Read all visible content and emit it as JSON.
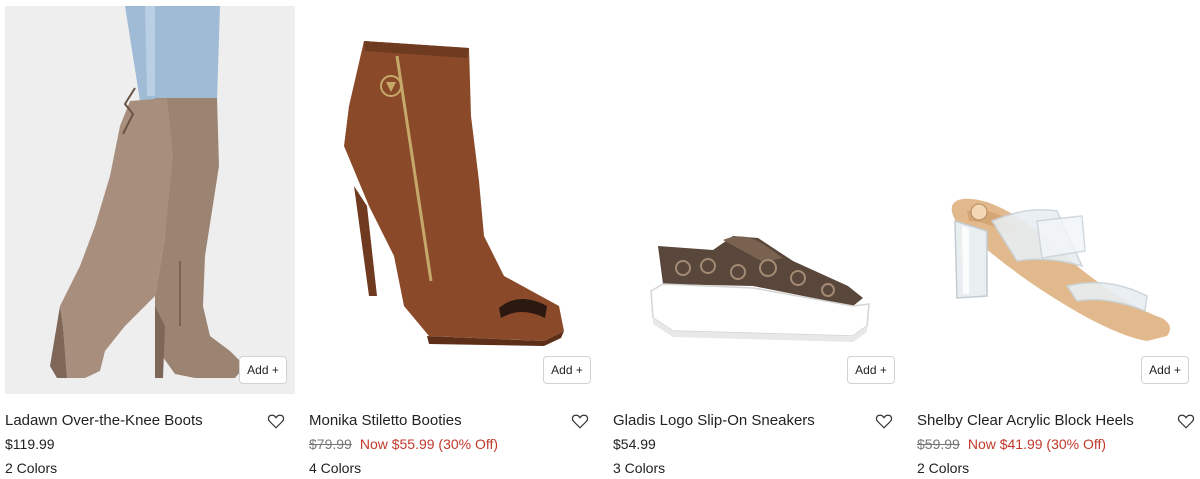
{
  "products": [
    {
      "name": "Ladawn Over-the-Knee Boots",
      "price": "$119.99",
      "original_price": "",
      "sale_price": "",
      "colors": "2 Colors",
      "add_label": "Add +",
      "image_icon": "over-the-knee-boot-image"
    },
    {
      "name": "Monika Stiletto Booties",
      "price": "",
      "original_price": "$79.99",
      "sale_price": "Now $55.99 (30% Off)",
      "colors": "4 Colors",
      "add_label": "Add +",
      "image_icon": "stiletto-bootie-image"
    },
    {
      "name": "Gladis Logo Slip-On Sneakers",
      "price": "$54.99",
      "original_price": "",
      "sale_price": "",
      "colors": "3 Colors",
      "add_label": "Add +",
      "image_icon": "slip-on-sneaker-image"
    },
    {
      "name": "Shelby Clear Acrylic Block Heels",
      "price": "",
      "original_price": "$59.99",
      "sale_price": "Now $41.99 (30% Off)",
      "colors": "2 Colors",
      "add_label": "Add +",
      "image_icon": "clear-block-heel-image"
    }
  ],
  "theme": {
    "sale_color": "#c0392b",
    "strike_color": "#777777",
    "text_color": "#222222"
  },
  "icons": {
    "wishlist": "heart-outline-icon"
  }
}
